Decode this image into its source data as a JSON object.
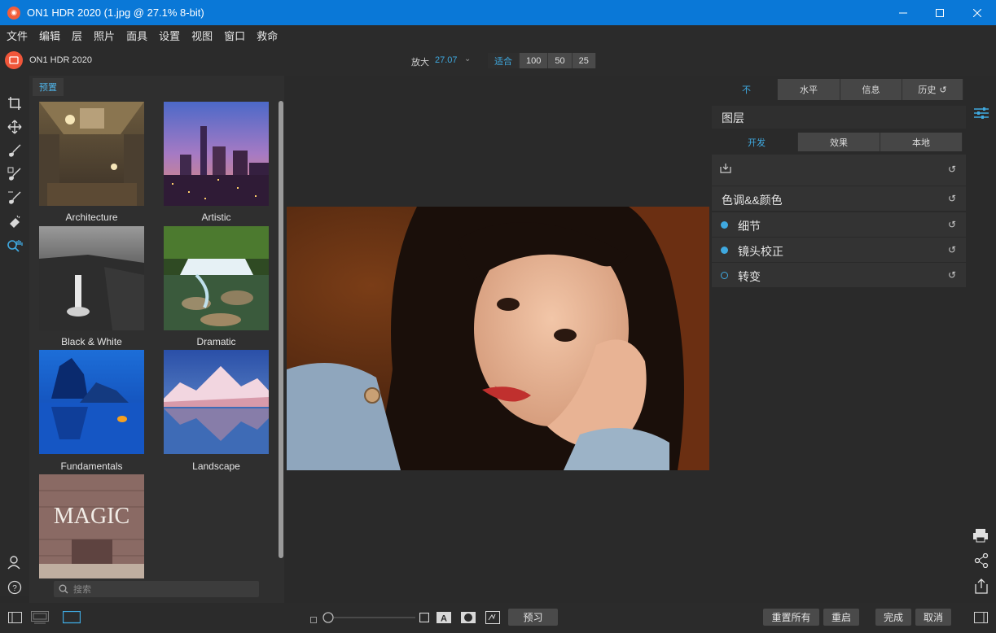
{
  "window": {
    "title": "ON1 HDR 2020 (1.jpg @ 27.1% 8-bit)",
    "minimize_icon": "minimize-icon",
    "maximize_icon": "maximize-icon",
    "close_icon": "close-icon"
  },
  "menu": {
    "items": [
      "文件",
      "编辑",
      "层",
      "照片",
      "面具",
      "设置",
      "视图",
      "窗口",
      "救命"
    ]
  },
  "toolbar": {
    "brand": "ON1 HDR 2020",
    "zoom_label": "放大",
    "zoom_value": "27.07",
    "zoom_presets": [
      "适合",
      "100",
      "50",
      "25"
    ],
    "active_zoom_preset": "适合"
  },
  "left_tools": [
    "crop-icon",
    "move-icon",
    "brush-icon",
    "masking-brush-icon",
    "refine-brush-icon",
    "eraser-icon",
    "zoom-hand-icon",
    "user-icon",
    "help-icon"
  ],
  "presets_panel": {
    "tab_label": "预置",
    "items": [
      {
        "label": "Architecture"
      },
      {
        "label": "Artistic"
      },
      {
        "label": "Black & White"
      },
      {
        "label": "Dramatic"
      },
      {
        "label": "Fundamentals"
      },
      {
        "label": "Landscape"
      },
      {
        "label": "",
        "thumbnail_text": "MAGIC"
      }
    ],
    "search_placeholder": "搜索"
  },
  "right_panel": {
    "top_tabs": [
      "不",
      "水平",
      "信息",
      "历史"
    ],
    "active_top_tab": "不",
    "layers_title": "图层",
    "sub_tabs": [
      "开发",
      "效果",
      "本地"
    ],
    "active_sub_tab": "开发",
    "sections": [
      {
        "label": "色调&&颜色",
        "state": "none"
      },
      {
        "label": "细节",
        "state": "on"
      },
      {
        "label": "镜头校正",
        "state": "on"
      },
      {
        "label": "转变",
        "state": "off"
      }
    ]
  },
  "right_strip_icons": [
    "adjust-sliders-icon",
    "print-icon",
    "share-icon",
    "export-icon"
  ],
  "bottom_bar": {
    "preview_label": "预习",
    "reset_all_label": "重置所有",
    "restart_label": "重启",
    "done_label": "完成",
    "cancel_label": "取消"
  },
  "colors": {
    "titlebar": "#0a78d7",
    "accent": "#3fa9e0",
    "brand": "#f0563a",
    "background": "#2a2a2a"
  }
}
